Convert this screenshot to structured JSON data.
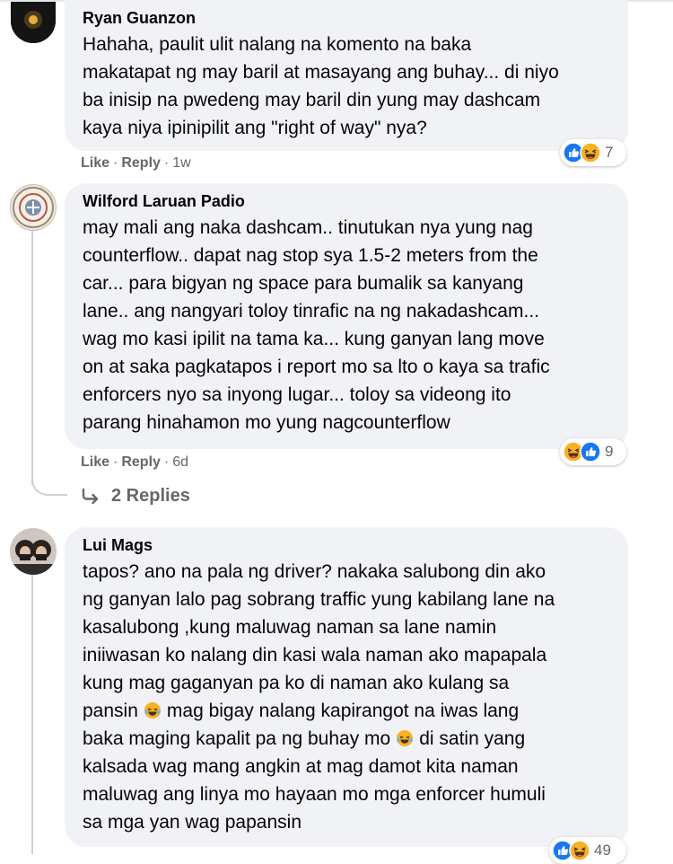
{
  "comments": [
    {
      "author": "Ryan Guanzon",
      "lines": [
        "Hahaha, paulit ulit nalang na komento na baka",
        "makatapat ng may baril at masayang ang buhay... di niyo",
        "ba inisip na pwedeng may baril din yung may dashcam",
        "kaya niya ipinipilit ang \"right of way\" nya?"
      ],
      "reaction_count": "7",
      "reactions": [
        "like",
        "haha"
      ],
      "like_label": "Like",
      "reply_label": "Reply",
      "time": "1w"
    },
    {
      "author": "Wilford Laruan Padio",
      "lines": [
        "may mali ang naka dashcam.. tinutukan nya yung nag",
        "counterflow.. dapat nag stop sya 1.5-2 meters from the",
        "car... para bigyan ng space para bumalik sa kanyang",
        "lane.. ang nangyari toloy tinrafic na ng nakadashcam...",
        "wag mo kasi ipilit na tama ka... kung ganyan lang move",
        "on at saka pagkatapos i report mo sa lto o kaya sa trafic",
        "enforcers nyo sa inyong lugar... toloy sa videong ito",
        "parang hinahamon mo yung nagcounterflow"
      ],
      "reaction_count": "9",
      "reactions": [
        "haha",
        "like"
      ],
      "like_label": "Like",
      "reply_label": "Reply",
      "time": "6d",
      "replies_label": "2 Replies"
    },
    {
      "author": "Lui Mags",
      "lines": [
        "tapos? ano na pala ng driver? nakaka salubong din ako",
        "ng ganyan lalo pag sobrang traffic yung kabilang lane na",
        "kasalubong ,kung maluwag naman sa lane namin",
        "iniiwasan ko nalang din kasi wala naman ako mapapala",
        "kung mag gaganyan pa ko di naman ako kulang sa",
        "pansin",
        "mag bigay nalang kapirangot na iwas lang",
        "baka maging kapalit pa ng buhay mo",
        "di satin yang",
        "kalsada wag mang angkin at mag damot kita naman",
        "maluwag ang linya mo hayaan mo mga enforcer humuli",
        "sa mga yan wag papansin"
      ],
      "reaction_count": "49",
      "reactions": [
        "like",
        "haha"
      ]
    }
  ],
  "icons": {
    "like_color": "#1877f2",
    "haha_color": "#f7b125",
    "replies_arrow": "reply-arrow-icon",
    "inline_emoji": "tears-of-joy-emoji-icon"
  }
}
